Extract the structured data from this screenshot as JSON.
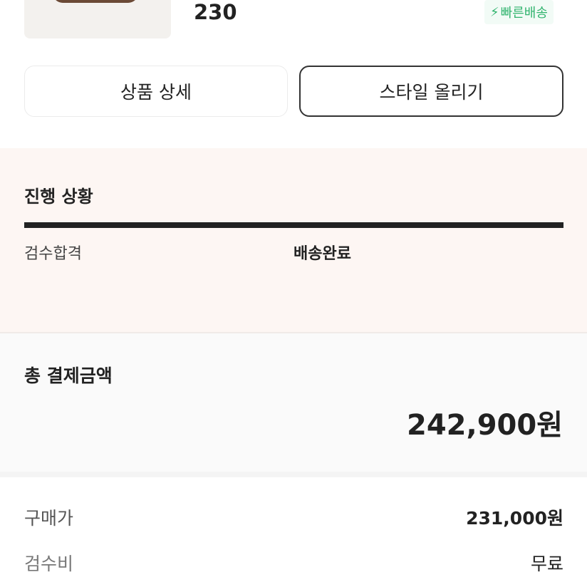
{
  "product": {
    "size": "230",
    "fast_delivery_icon": "lightning-bolt-icon",
    "fast_delivery_label": "빠른배송"
  },
  "actions": {
    "detail_label": "상품 상세",
    "style_label": "스타일 올리기"
  },
  "progress": {
    "title": "진행 상황",
    "completion": 1.0,
    "steps": [
      {
        "label": "검수합격"
      },
      {
        "label": "배송완료"
      }
    ]
  },
  "payment": {
    "total_label": "총 결제금액",
    "total_amount": "242,900원",
    "lines": [
      {
        "label": "구매가",
        "value": "231,000원"
      },
      {
        "label": "검수비",
        "value": "무료"
      }
    ]
  },
  "colors": {
    "accent_green": "#31b46e",
    "progress_bg": "#fdf6f3",
    "text_primary": "#222222"
  }
}
